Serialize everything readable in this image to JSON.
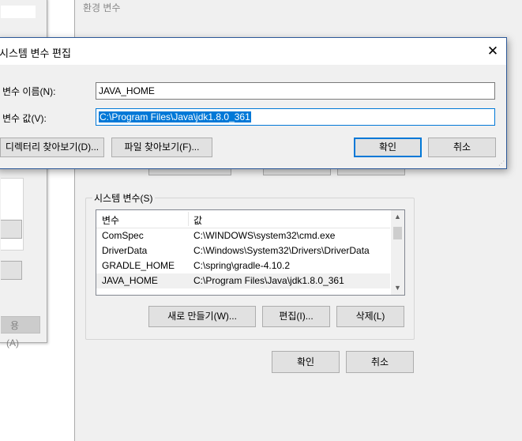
{
  "background_window": {
    "apply_button": "용(A)"
  },
  "env_window": {
    "title": "환경 변수",
    "hidden_buttons": [
      "",
      "",
      ""
    ],
    "system_vars": {
      "group_label": "시스템 변수(S)",
      "columns": [
        "변수",
        "값"
      ],
      "rows": [
        {
          "name": "ComSpec",
          "value": "C:\\WINDOWS\\system32\\cmd.exe"
        },
        {
          "name": "DriverData",
          "value": "C:\\Windows\\System32\\Drivers\\DriverData"
        },
        {
          "name": "GRADLE_HOME",
          "value": "C:\\spring\\gradle-4.10.2"
        },
        {
          "name": "JAVA_HOME",
          "value": "C:\\Program Files\\Java\\jdk1.8.0_361"
        }
      ],
      "selected_row": 3,
      "new_button": "새로 만들기(W)...",
      "edit_button": "편집(I)...",
      "delete_button": "삭제(L)"
    },
    "ok_button": "확인",
    "cancel_button": "취소"
  },
  "dialog": {
    "title": "시스템 변수 편집",
    "name_label": "변수 이름(N):",
    "name_value": "JAVA_HOME",
    "value_label": "변수 값(V):",
    "value_value": "C:\\Program Files\\Java\\jdk1.8.0_361",
    "browse_dir_button": "디렉터리 찾아보기(D)...",
    "browse_file_button": "파일 찾아보기(F)...",
    "ok_button": "확인",
    "cancel_button": "취소"
  },
  "colors": {
    "accent": "#0078d7",
    "window_bg": "#f0f0f0",
    "button_bg": "#e1e1e1"
  }
}
